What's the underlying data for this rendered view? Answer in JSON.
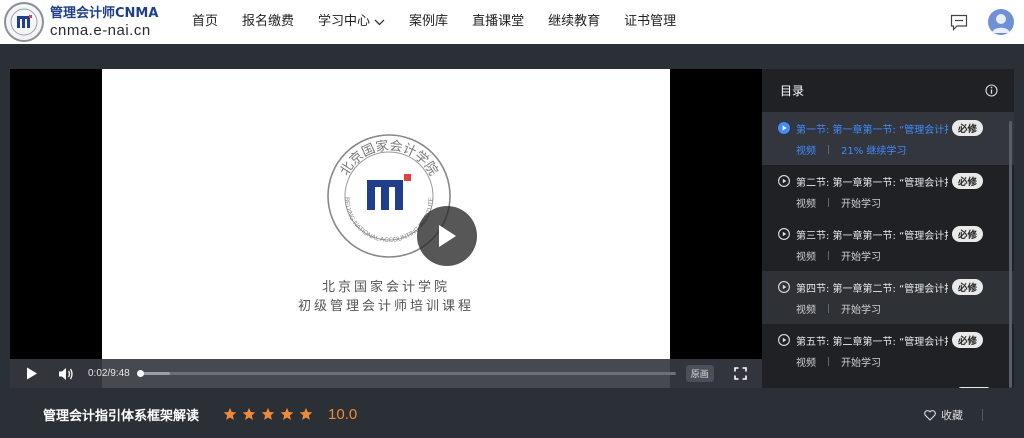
{
  "header": {
    "logo_title": "管理会计师CNMA",
    "logo_sub": "cnma.e-nai.cn",
    "nav": [
      {
        "label": "首页"
      },
      {
        "label": "报名缴费"
      },
      {
        "label": "学习中心",
        "has_dropdown": true
      },
      {
        "label": "案例库"
      },
      {
        "label": "直播课堂"
      },
      {
        "label": "继续教育"
      },
      {
        "label": "证书管理"
      }
    ],
    "icons": {
      "message": "message-icon",
      "user": "avatar-icon",
      "dropdown": "chevron-down-icon"
    }
  },
  "player": {
    "slide_line1": "北京国家会计学院",
    "slide_line2": "初级管理会计师培训课程",
    "emblem_text_top": "北京国家会计学院",
    "emblem_text_bottom": "BEIJING NATIONAL ACCOUNTING INSTITUTE",
    "time": "0:02/9:48",
    "progress": 0.0034,
    "buffered": 0.06,
    "quality": "原画"
  },
  "course": {
    "title": "管理会计指引体系框架解读",
    "stars": 5,
    "rating": "10.0",
    "favorite_label": "收藏"
  },
  "catalog": {
    "title": "目录",
    "items": [
      {
        "name": "第一节: 第一章第一节: “管理会计指引体系框架解读”",
        "badge": "必修",
        "type": "视频",
        "status": "21% 继续学习",
        "active": true
      },
      {
        "name": "第二节: 第一章第一节: “管理会计指引体系框架解读”",
        "badge": "必修",
        "type": "视频",
        "status": "开始学习"
      },
      {
        "name": "第三节: 第一章第一节: “管理会计指引体系框架解读”",
        "badge": "必修",
        "type": "视频",
        "status": "开始学习"
      },
      {
        "name": "第四节: 第一章第二节: “管理会计指引体系框架解读”",
        "badge": "必修",
        "type": "视频",
        "status": "开始学习",
        "hover": true
      },
      {
        "name": "第五节: 第二章第一节: “管理会计指引体系框架解读”",
        "badge": "必修",
        "type": "视频",
        "status": "开始学习"
      }
    ]
  },
  "colors": {
    "accent": "#3f8bff",
    "rating": "#f08a36",
    "page_bg": "#2b2f36",
    "header_bg": "#ffffff"
  }
}
